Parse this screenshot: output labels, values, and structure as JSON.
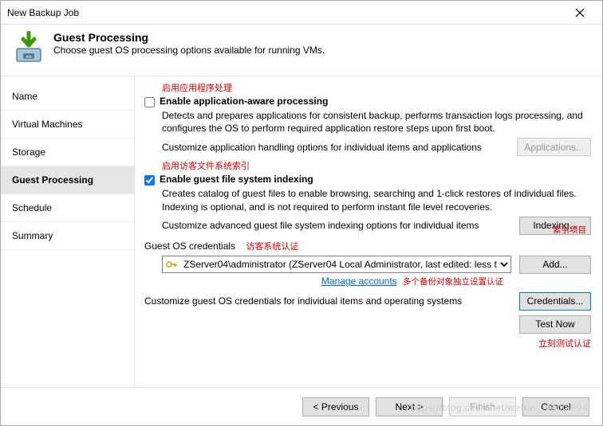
{
  "window": {
    "title": "New Backup Job"
  },
  "header": {
    "title": "Guest Processing",
    "subtitle": "Choose guest OS processing options available for running VMs."
  },
  "sidebar": [
    {
      "label": "Name"
    },
    {
      "label": "Virtual Machines"
    },
    {
      "label": "Storage"
    },
    {
      "label": "Guest Processing"
    },
    {
      "label": "Schedule"
    },
    {
      "label": "Summary"
    }
  ],
  "annotations": {
    "a1": "启用应用程序处理",
    "a2": "启用访客文件系统索引",
    "a3": "访客系统认证",
    "a4": "索引项目",
    "a5": "多个备份对象独立设置认证",
    "a6": "立刻测试认证"
  },
  "opt1": {
    "title": "Enable application-aware processing",
    "desc": "Detects and prepares applications for consistent backup, performs transaction logs processing, and configures the OS to perform required application restore steps upon first boot.",
    "subline": "Customize application handling options for individual items and applications",
    "btn": "Applications..."
  },
  "opt2": {
    "title": "Enable guest file system indexing",
    "desc": "Creates catalog of guest files to enable browsing, searching and 1-click restores of individual files. Indexing is optional, and is not required to perform instant file level recoveries.",
    "subline": "Customize advanced guest file system indexing options for individual items",
    "btn": "Indexing..."
  },
  "creds": {
    "label": "Guest OS credentials",
    "value": "ZServer04\\administrator (ZServer04 Local Administrator, last edited: less t",
    "add": "Add...",
    "manage": "Manage accounts",
    "line": "Customize guest OS credentials for individual items and operating systems",
    "btn": "Credentials...",
    "test": "Test Now"
  },
  "footer": {
    "prev": "< Previous",
    "next": "Next >",
    "finish": "Finish",
    "cancel": "Cancel"
  },
  "watermark": "https://blog.csdn.net/weixin_36023994"
}
